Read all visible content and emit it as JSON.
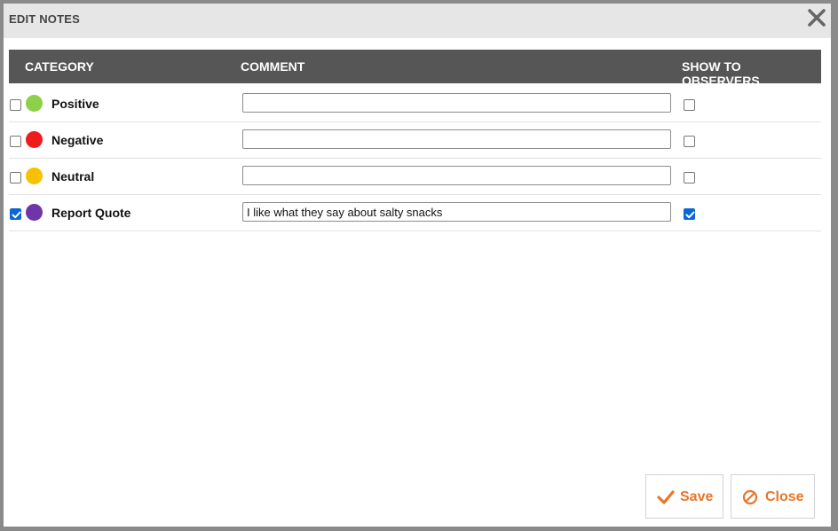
{
  "dialog": {
    "title": "EDIT NOTES",
    "close_icon": "close-icon"
  },
  "table": {
    "headers": {
      "category": "CATEGORY",
      "comment": "COMMENT",
      "show_to_observers": "SHOW TO OBSERVERS"
    },
    "rows": [
      {
        "category": "Positive",
        "color": "#8cd148",
        "checked": false,
        "comment": "",
        "show_to_observers": false
      },
      {
        "category": "Negative",
        "color": "#ee1c1c",
        "checked": false,
        "comment": "",
        "show_to_observers": false
      },
      {
        "category": "Neutral",
        "color": "#f8c100",
        "checked": false,
        "comment": "",
        "show_to_observers": false
      },
      {
        "category": "Report Quote",
        "color": "#6f36a7",
        "checked": true,
        "comment": "I like what they say about salty snacks",
        "show_to_observers": true
      }
    ]
  },
  "buttons": {
    "save_label": "Save",
    "save_icon": "checkmark-icon",
    "close_label": "Close",
    "close_icon": "ban-icon"
  },
  "colors": {
    "accent": "#e8762b",
    "header_bg": "#565656",
    "checkbox_checked": "#0b67d6"
  }
}
